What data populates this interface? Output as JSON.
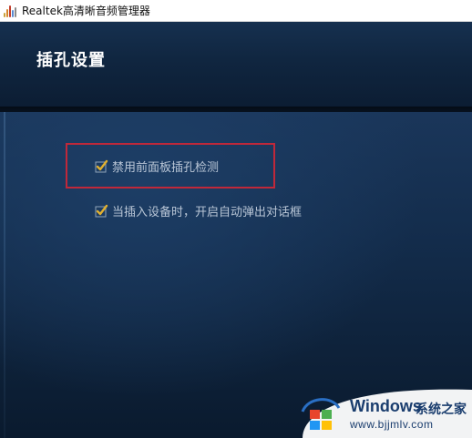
{
  "window": {
    "title": "Realtek高清晰音频管理器",
    "icon": "realtek-audio-icon"
  },
  "header": {
    "title": "插孔设置"
  },
  "options": [
    {
      "label": "禁用前面板插孔检测",
      "checked": true,
      "highlighted": true
    },
    {
      "label": "当插入设备时，开启自动弹出对话框",
      "checked": true,
      "highlighted": false
    }
  ],
  "watermark": {
    "brand": "Windows",
    "cn": "系统之家",
    "url": "www.bjjmlv.com"
  },
  "colors": {
    "highlight_border": "#c0283a",
    "checkmark": "#e0b030",
    "panel_bg": "#132c4b",
    "option_text": "#b9c6d6"
  }
}
